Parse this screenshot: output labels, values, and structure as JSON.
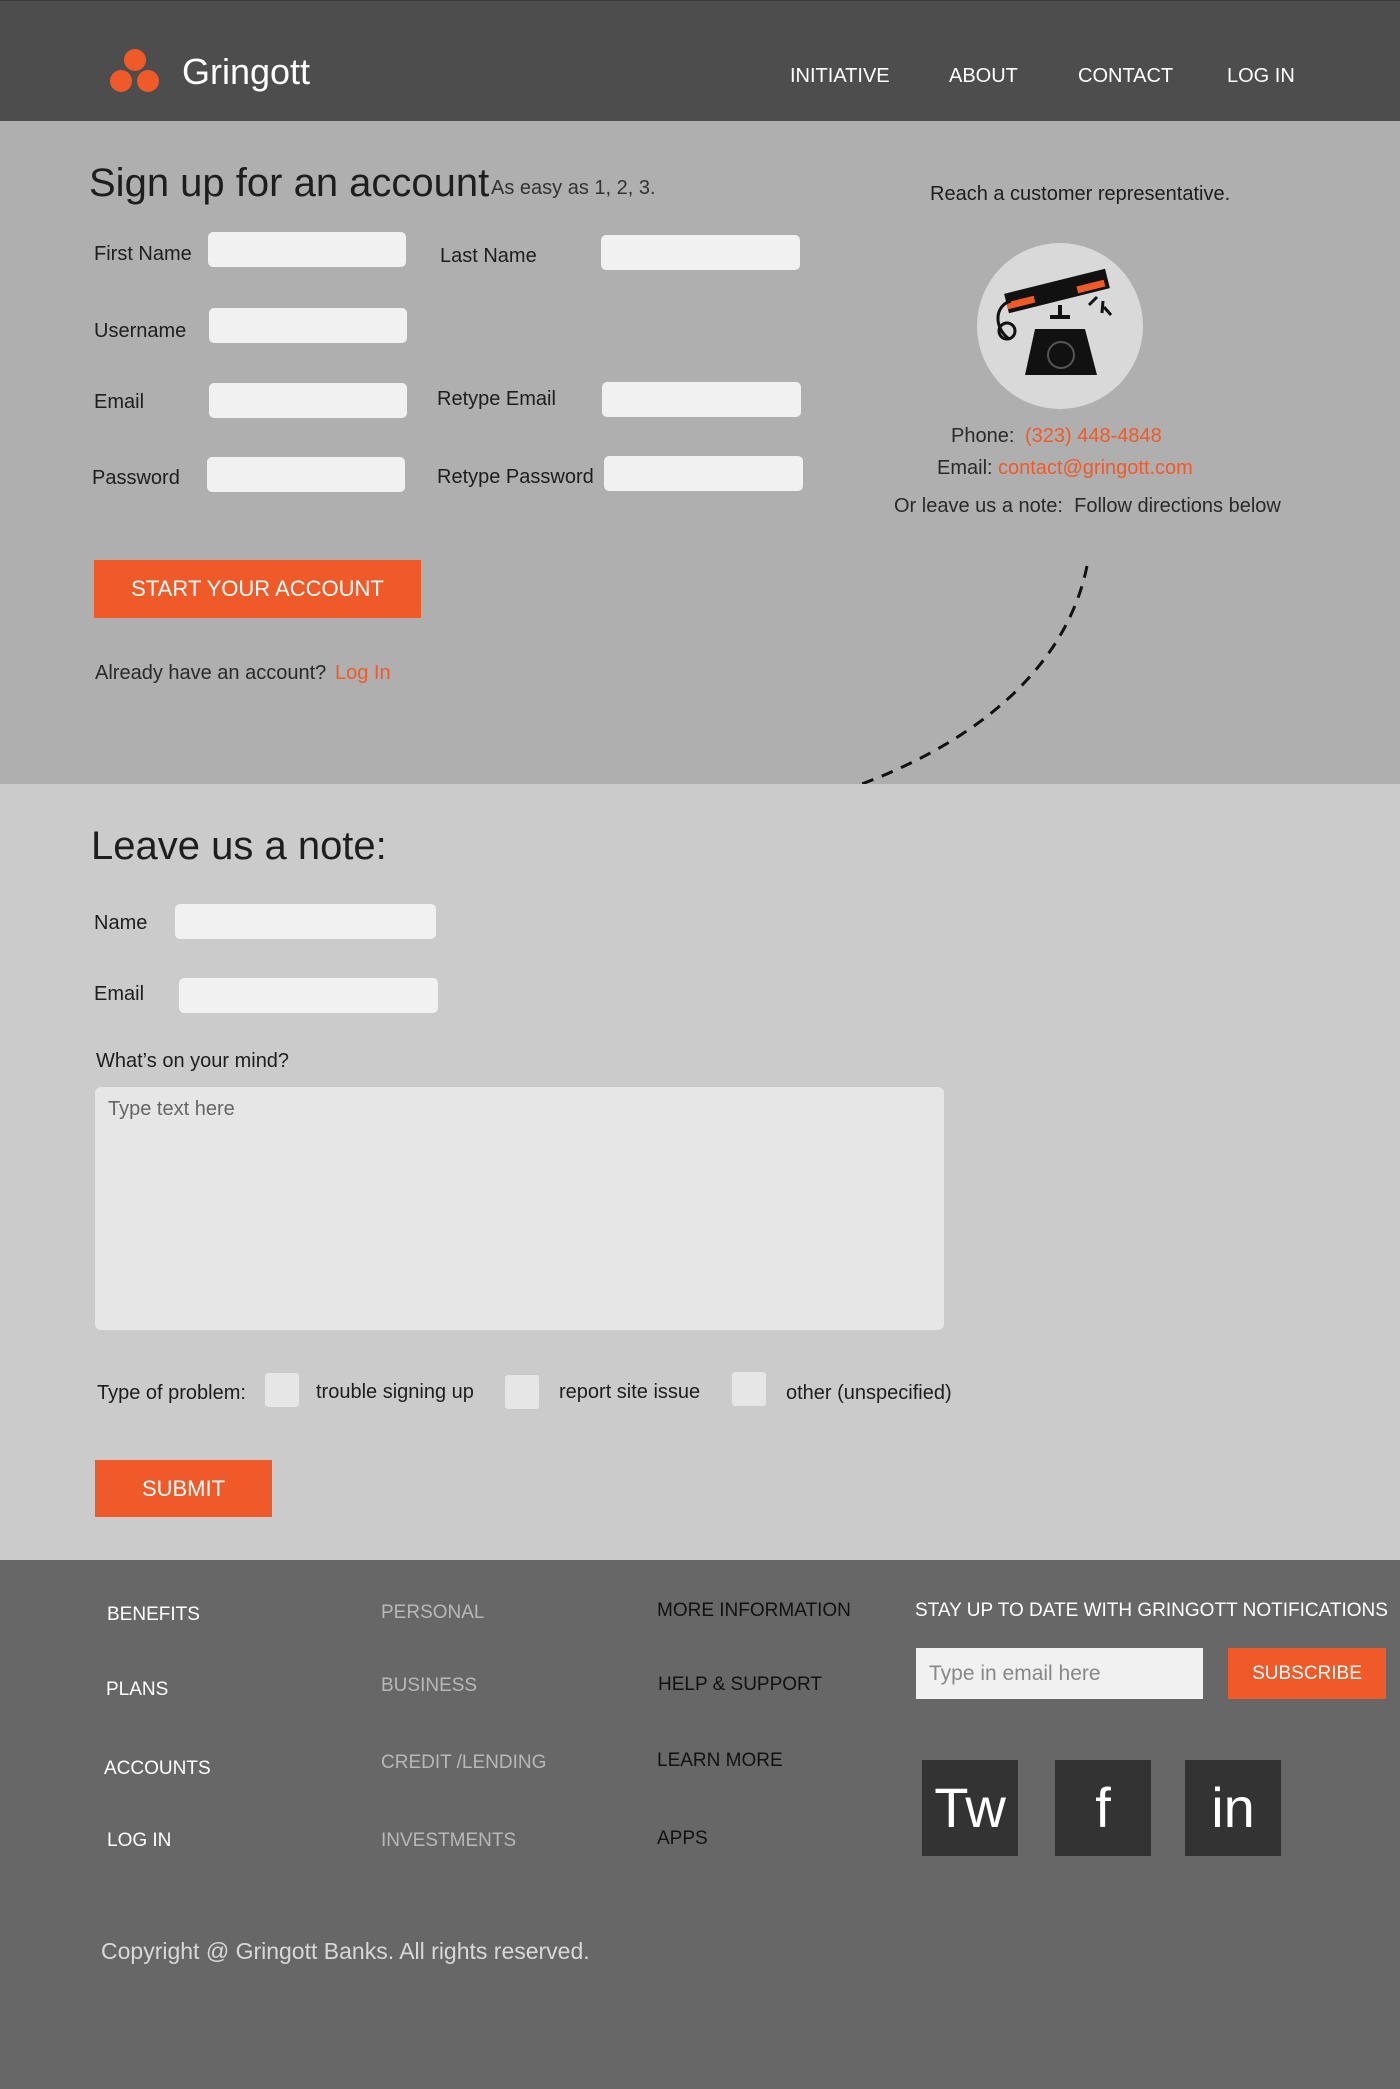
{
  "brand": {
    "name": "Gringott",
    "accent": "#f05a28"
  },
  "nav": [
    "INITIATIVE",
    "ABOUT",
    "CONTACT",
    "LOG IN"
  ],
  "signup": {
    "title": "Sign up for an account",
    "subtitle": "As easy as 1, 2, 3.",
    "fields": {
      "first_name": "First Name",
      "last_name": "Last Name",
      "username": "Username",
      "email": "Email",
      "retype_email": "Retype Email",
      "password": "Password",
      "retype_password": "Retype Password"
    },
    "button": "START YOUR ACCOUNT",
    "already": "Already have an account?",
    "login_link": "Log In"
  },
  "contact": {
    "heading": "Reach a customer representative.",
    "phone_label": "Phone:",
    "phone_value": "(323) 448-4848",
    "email_label": "Email:",
    "email_value": "contact@gringott.com",
    "note_text": "Or leave us a note:  Follow directions below"
  },
  "note": {
    "title": "Leave us a note:",
    "name_label": "Name",
    "email_label": "Email",
    "mind_label": "What’s on your mind?",
    "textarea_placeholder": "Type text here",
    "problem_label": "Type of problem:",
    "options": [
      "trouble signing up",
      "report site issue",
      "other (unspecified)"
    ],
    "submit": "SUBMIT"
  },
  "footer": {
    "col1": [
      "BENEFITS",
      "PLANS",
      "ACCOUNTS",
      "LOG IN"
    ],
    "col2": [
      "PERSONAL",
      "BUSINESS",
      "CREDIT /LENDING",
      "INVESTMENTS"
    ],
    "col3": [
      "MORE INFORMATION",
      "HELP & SUPPORT",
      "LEARN MORE",
      "APPS"
    ],
    "newsletter_heading": "STAY UP TO DATE WITH GRINGOTT NOTIFICATIONS",
    "email_placeholder": "Type in email here",
    "subscribe": "SUBSCRIBE",
    "social": [
      "Tw",
      "f",
      "in"
    ],
    "copyright": "Copyright @ Gringott Banks. All rights reserved."
  }
}
